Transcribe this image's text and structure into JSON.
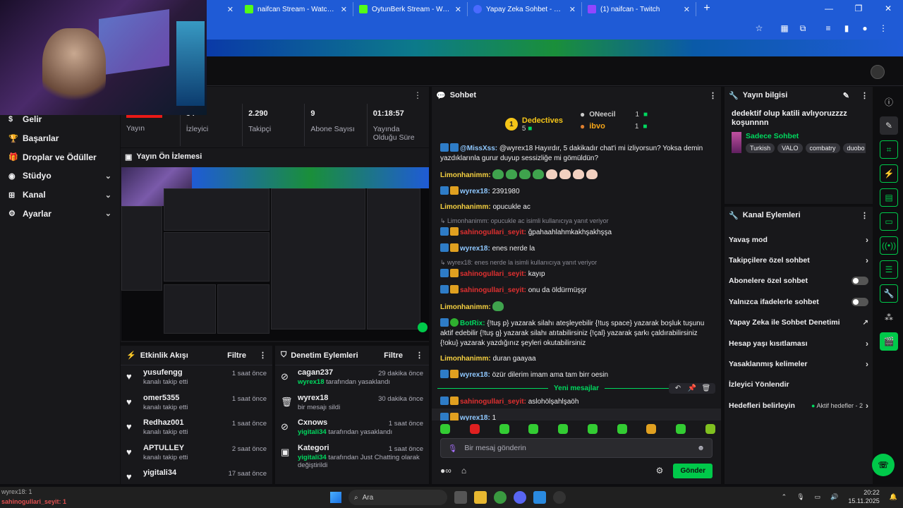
{
  "browser": {
    "tabs": [
      {
        "title": "naifcan Stream - Watch Live on",
        "color": "#53fc18",
        "active": false
      },
      {
        "title": "OytunBerk Stream - Watch Live",
        "color": "#53fc18",
        "active": false
      },
      {
        "title": "Yapay Zeka Sohbet - MissXss AI",
        "color": "#4a6aff",
        "active": false
      },
      {
        "title": "(1) naifcan - Twitch",
        "color": "#9146ff",
        "active": false
      }
    ]
  },
  "nav": {
    "items": [
      {
        "label": "Gelir",
        "icon": "$",
        "chevron": false
      },
      {
        "label": "Başarılar",
        "icon": "🏆",
        "chevron": false
      },
      {
        "label": "Droplar ve Ödüller",
        "icon": "🎁",
        "chevron": false
      },
      {
        "label": "Stüdyo",
        "icon": "◉",
        "chevron": true
      },
      {
        "label": "Kanal",
        "icon": "⊞",
        "chevron": true
      },
      {
        "label": "Ayarlar",
        "icon": "⚙",
        "chevron": true
      }
    ]
  },
  "stats": {
    "live": {
      "badge": "YAYINDA",
      "label": "Yayın"
    },
    "viewers": {
      "value": "34",
      "label": "İzleyici"
    },
    "followers": {
      "value": "2.290",
      "label": "Takipçi"
    },
    "subs": {
      "value": "9",
      "label": "Abone Sayısı"
    },
    "uptime": {
      "value": "01:18:57",
      "label": "Yayında Olduğu Süre"
    }
  },
  "preview": {
    "title": "Yayın Ön İzlemesi"
  },
  "activity": {
    "title": "Etkinlik Akışı",
    "filter": "Filtre",
    "items": [
      {
        "name": "yusufengg",
        "sub": "kanalı takip etti",
        "time": "1 saat önce"
      },
      {
        "name": "omer5355",
        "sub": "kanalı takip etti",
        "time": "1 saat önce"
      },
      {
        "name": "Redhaz001",
        "sub": "kanalı takip etti",
        "time": "1 saat önce"
      },
      {
        "name": "APTULLEY",
        "sub": "kanalı takip etti",
        "time": "2 saat önce"
      },
      {
        "name": "yigitali34",
        "sub": "",
        "time": "17 saat önce"
      }
    ]
  },
  "moderation": {
    "title": "Denetim Eylemleri",
    "filter": "Filtre",
    "items": [
      {
        "icon": "⊘",
        "name": "cagan237",
        "actor": "wyrex18",
        "rest": "tarafından yasaklandı",
        "time": "29 dakika önce"
      },
      {
        "icon": "🗑",
        "name": "wyrex18",
        "actor": "",
        "rest": "bir mesajı sildi",
        "time": "30 dakika önce"
      },
      {
        "icon": "⊘",
        "name": "Cxnows",
        "actor": "yigitali34",
        "rest": "tarafından yasaklandı",
        "time": "1 saat önce"
      },
      {
        "icon": "▣",
        "name": "Kategori",
        "actor": "yigitali34",
        "rest": "tarafından Just Chatting olarak değiştirildi",
        "time": "1 saat önce"
      }
    ]
  },
  "chat": {
    "title": "Sohbet",
    "leaderboard": {
      "first": {
        "rank": "1",
        "name": "Dedectives",
        "score": "5"
      },
      "second": {
        "name": "ONeecil",
        "score": "1"
      },
      "third": {
        "name": "ibvo",
        "score": "1"
      }
    },
    "new_messages": "Yeni mesajlar",
    "input_placeholder": "Bir mesaj gönderin",
    "send": "Gönder"
  },
  "info": {
    "title": "Yayın bilgisi",
    "stream_title": "dedektif olup katili avlıyoruzzzz koşunnnn",
    "category": "Sadece Sohbet",
    "tags": [
      "Turkish",
      "VALO",
      "combatry",
      "duobo"
    ]
  },
  "actions": {
    "title": "Kanal Eylemleri",
    "items": [
      {
        "label": "Yavaş mod",
        "type": "chevron"
      },
      {
        "label": "Takipçilere özel sohbet",
        "type": "chevron"
      },
      {
        "label": "Abonelere özel sohbet",
        "type": "toggle"
      },
      {
        "label": "Yalnızca ifadelerle sohbet",
        "type": "toggle"
      },
      {
        "label": "Yapay Zeka ile Sohbet Denetimi",
        "type": "ext"
      },
      {
        "label": "Hesap yaşı kısıtlaması",
        "type": "chevron"
      },
      {
        "label": "Yasaklanmış kelimeler",
        "type": "chevron"
      },
      {
        "label": "İzleyici Yönlendir",
        "type": "none"
      },
      {
        "label": "Hedefleri belirleyin",
        "type": "chevron",
        "sub": "Aktif hedefler - 2"
      }
    ]
  },
  "taskbar": {
    "overlay_a": "wyrex18: 1",
    "overlay_b": "sahinogullari_seyit: 1",
    "search": "Ara",
    "time": "20:22",
    "date": "15.11.2025"
  },
  "colors": {
    "accent": "#00c94a",
    "live": "#e91916",
    "brand": "#1f5bd6"
  }
}
